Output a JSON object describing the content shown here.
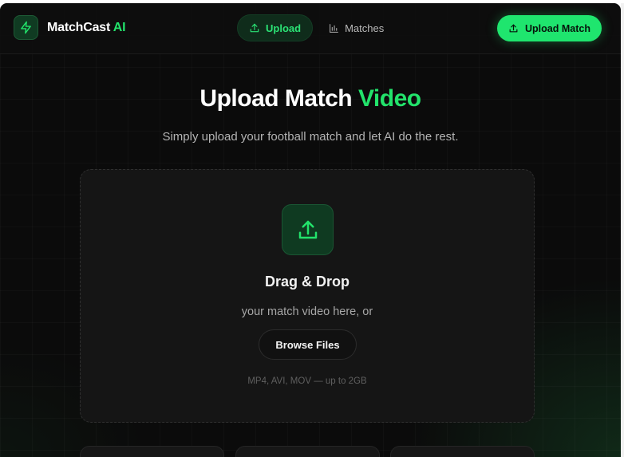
{
  "brand": {
    "name": "MatchCast",
    "accent": "AI",
    "icon": "bolt-icon"
  },
  "nav": {
    "items": [
      {
        "label": "Upload",
        "icon": "upload-icon",
        "active": true
      },
      {
        "label": "Matches",
        "icon": "bar-chart-icon",
        "active": false
      }
    ]
  },
  "header": {
    "cta_label": "Upload Match",
    "cta_icon": "upload-icon"
  },
  "hero": {
    "title_main": "Upload Match",
    "title_accent": "Video",
    "subtitle": "Simply upload your football match and let AI do the rest."
  },
  "dropzone": {
    "icon": "upload-icon",
    "title": "Drag & Drop",
    "subtitle": "your match video here, or",
    "browse_label": "Browse Files",
    "hint": "MP4, AVI, MOV — up to 2GB"
  },
  "colors": {
    "accent": "#22e36b",
    "background": "#0b0b0b",
    "card": "#151515"
  }
}
